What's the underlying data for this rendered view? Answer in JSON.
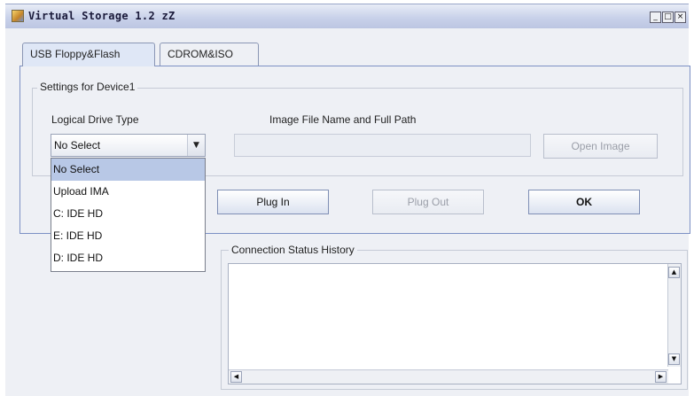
{
  "window": {
    "title": "Virtual Storage 1.2 zZ",
    "min_glyph": "_",
    "max_glyph": "□",
    "close_glyph": "×"
  },
  "tabs": [
    {
      "label": "USB Floppy&Flash",
      "active": true
    },
    {
      "label": "CDROM&ISO",
      "active": false
    }
  ],
  "settings": {
    "group_title": "Settings for Device1",
    "drive_type_label": "Logical Drive Type",
    "image_path_label": "Image File Name and Full Path",
    "image_path_value": "",
    "drive_type_selected": "No Select",
    "drive_type_options": [
      "No Select",
      "Upload IMA",
      "C: IDE HD",
      "E: IDE HD",
      "D: IDE HD"
    ],
    "dropdown_open": true
  },
  "buttons": {
    "open_image": {
      "label": "Open Image",
      "enabled": false
    },
    "plug_in": {
      "label": "Plug In",
      "enabled": true
    },
    "plug_out": {
      "label": "Plug Out",
      "enabled": false
    },
    "ok": {
      "label": "OK",
      "enabled": true
    }
  },
  "status": {
    "group_title": "Connection Status History",
    "log_text": ""
  },
  "icons": {
    "app": "app-icon",
    "combo_arrow": "▼",
    "scroll_up": "▲",
    "scroll_down": "▼",
    "scroll_left": "◀",
    "scroll_right": "▶"
  },
  "colors": {
    "panel_bg": "#eef0f5",
    "active_tab_bg": "#dfe7f6",
    "selection_bg": "#b8c8e6",
    "disabled_text": "#9a9ea8",
    "panel_border": "#7c90c4"
  }
}
